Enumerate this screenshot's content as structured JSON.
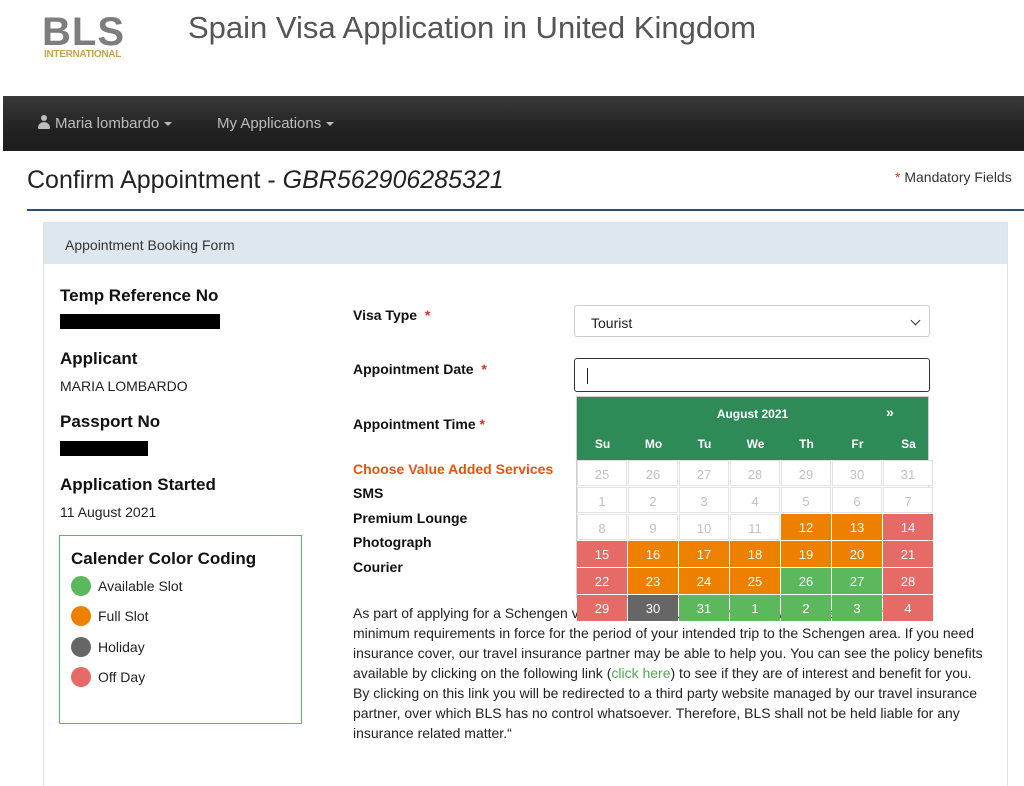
{
  "brand": {
    "logo_main": "BLS",
    "logo_sub": "INTERNATIONAL"
  },
  "site_title": "Spain Visa Application in United Kingdom",
  "nav": {
    "user": "Maria lombardo",
    "apps": "My Applications"
  },
  "heading": {
    "prefix": "Confirm Appointment - ",
    "ref": "GBR562906285321"
  },
  "mandatory": {
    "star": "*",
    "label": "Mandatory Fields"
  },
  "panel_title": "Appointment Booking Form",
  "summary": {
    "temp_ref_label": "Temp Reference No",
    "applicant_label": "Applicant",
    "applicant_value": "MARIA LOMBARDO",
    "passport_label": "Passport No",
    "started_label": "Application Started",
    "started_value": "11 August 2021"
  },
  "legend": {
    "title": "Calender Color Coding",
    "items": [
      {
        "label": "Available Slot",
        "color": "#5cb85c"
      },
      {
        "label": "Full Slot",
        "color": "#ee8000"
      },
      {
        "label": "Holiday",
        "color": "#666666"
      },
      {
        "label": "Off Day",
        "color": "#e66a66"
      }
    ]
  },
  "form": {
    "visa_type_label": "Visa Type",
    "visa_type_value": "Tourist",
    "date_label": "Appointment Date",
    "date_value": "",
    "time_label": "Appointment Time",
    "required_mark": "*"
  },
  "services": {
    "title": "Choose Value Added Services",
    "items": [
      "SMS",
      "Premium Lounge",
      "Photograph",
      "Courier"
    ]
  },
  "insurance": {
    "text_before": "As part of applying for a Schengen visa, you are required to have travel insurance that meets minimum requirements in force for the period of your intended trip to the Schengen area. If you need insurance cover, our travel insurance partner may be able to help you. You can see the policy benefits available by clicking on the following link (",
    "link": "click here",
    "text_after": ") to see if they are of interest and benefit for you. By clicking on this link you will be redirected to a third party website managed by our travel insurance partner, over which BLS has no control whatsoever. Therefore, BLS shall not be held liable for any insurance related matter.“"
  },
  "calendar": {
    "month": "August 2021",
    "next": "»",
    "weekdays": [
      "Su",
      "Mo",
      "Tu",
      "We",
      "Th",
      "Fr",
      "Sa"
    ],
    "weeks": [
      [
        {
          "d": "25",
          "s": "disabled"
        },
        {
          "d": "26",
          "s": "disabled"
        },
        {
          "d": "27",
          "s": "disabled"
        },
        {
          "d": "28",
          "s": "disabled"
        },
        {
          "d": "29",
          "s": "disabled"
        },
        {
          "d": "30",
          "s": "disabled"
        },
        {
          "d": "31",
          "s": "disabled"
        }
      ],
      [
        {
          "d": "1",
          "s": "disabled"
        },
        {
          "d": "2",
          "s": "disabled"
        },
        {
          "d": "3",
          "s": "disabled"
        },
        {
          "d": "4",
          "s": "disabled"
        },
        {
          "d": "5",
          "s": "disabled"
        },
        {
          "d": "6",
          "s": "disabled"
        },
        {
          "d": "7",
          "s": "disabled"
        }
      ],
      [
        {
          "d": "8",
          "s": "disabled"
        },
        {
          "d": "9",
          "s": "disabled"
        },
        {
          "d": "10",
          "s": "disabled"
        },
        {
          "d": "11",
          "s": "disabled"
        },
        {
          "d": "12",
          "s": "full"
        },
        {
          "d": "13",
          "s": "full"
        },
        {
          "d": "14",
          "s": "off"
        }
      ],
      [
        {
          "d": "15",
          "s": "off"
        },
        {
          "d": "16",
          "s": "full"
        },
        {
          "d": "17",
          "s": "full"
        },
        {
          "d": "18",
          "s": "full"
        },
        {
          "d": "19",
          "s": "full"
        },
        {
          "d": "20",
          "s": "full"
        },
        {
          "d": "21",
          "s": "off"
        }
      ],
      [
        {
          "d": "22",
          "s": "off"
        },
        {
          "d": "23",
          "s": "full"
        },
        {
          "d": "24",
          "s": "full"
        },
        {
          "d": "25",
          "s": "full"
        },
        {
          "d": "26",
          "s": "avail"
        },
        {
          "d": "27",
          "s": "avail"
        },
        {
          "d": "28",
          "s": "off"
        }
      ],
      [
        {
          "d": "29",
          "s": "off"
        },
        {
          "d": "30",
          "s": "holiday"
        },
        {
          "d": "31",
          "s": "avail"
        },
        {
          "d": "1",
          "s": "avail"
        },
        {
          "d": "2",
          "s": "avail"
        },
        {
          "d": "3",
          "s": "avail"
        },
        {
          "d": "4",
          "s": "off"
        }
      ]
    ]
  }
}
